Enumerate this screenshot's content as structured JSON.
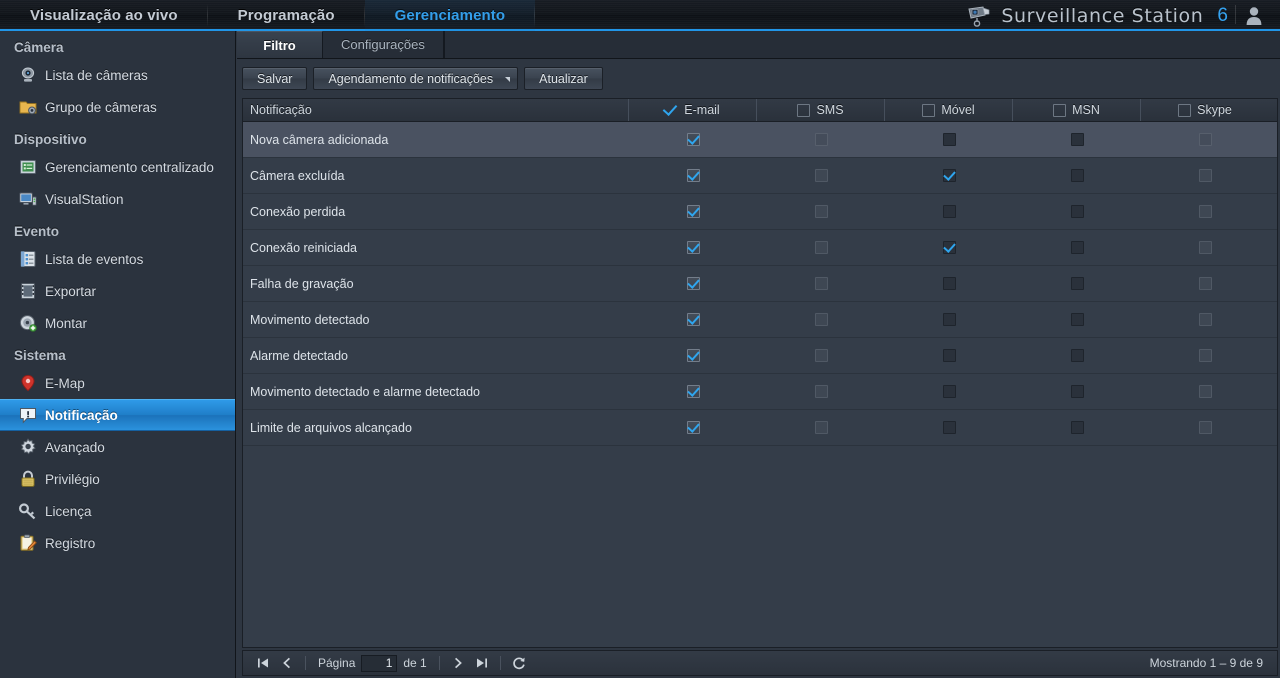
{
  "header": {
    "nav": [
      {
        "label": "Visualização ao vivo",
        "active": false
      },
      {
        "label": "Programação",
        "active": false
      },
      {
        "label": "Gerenciamento",
        "active": true
      }
    ],
    "brand": "Surveillance Station",
    "brand_version": "6",
    "camera_icon": "camera-icon",
    "user_icon": "user-icon",
    "accent": "#2196e8"
  },
  "sidebar": {
    "groups": [
      {
        "title": "Câmera",
        "items": [
          {
            "label": "Lista de câmeras",
            "icon": "camera-icon",
            "selected": false
          },
          {
            "label": "Grupo de câmeras",
            "icon": "folder-camera-icon",
            "selected": false
          }
        ]
      },
      {
        "title": "Dispositivo",
        "items": [
          {
            "label": "Gerenciamento centralizado",
            "icon": "server-list-icon",
            "selected": false
          },
          {
            "label": "VisualStation",
            "icon": "monitor-icon",
            "selected": false
          }
        ]
      },
      {
        "title": "Evento",
        "items": [
          {
            "label": "Lista de eventos",
            "icon": "event-list-icon",
            "selected": false
          },
          {
            "label": "Exportar",
            "icon": "film-export-icon",
            "selected": false
          },
          {
            "label": "Montar",
            "icon": "disc-mount-icon",
            "selected": false
          }
        ]
      },
      {
        "title": "Sistema",
        "items": [
          {
            "label": "E-Map",
            "icon": "map-pin-icon",
            "selected": false
          },
          {
            "label": "Notificação",
            "icon": "notification-bubble-icon",
            "selected": true
          },
          {
            "label": "Avançado",
            "icon": "gear-icon",
            "selected": false
          },
          {
            "label": "Privilégio",
            "icon": "lock-icon",
            "selected": false
          },
          {
            "label": "Licença",
            "icon": "key-icon",
            "selected": false
          },
          {
            "label": "Registro",
            "icon": "clipboard-pencil-icon",
            "selected": false
          }
        ]
      }
    ]
  },
  "main": {
    "tabs": [
      {
        "label": "Filtro",
        "active": true
      },
      {
        "label": "Configurações",
        "active": false
      }
    ],
    "toolbar": {
      "save_label": "Salvar",
      "schedule_label": "Agendamento de notificações",
      "refresh_label": "Atualizar"
    },
    "table": {
      "columns": [
        {
          "label": "Notificação",
          "type": "text",
          "header_checkbox": null
        },
        {
          "label": "E-mail",
          "type": "check",
          "header_checkbox": "checked"
        },
        {
          "label": "SMS",
          "type": "check",
          "header_checkbox": "unchecked"
        },
        {
          "label": "Móvel",
          "type": "check",
          "header_checkbox": "unchecked"
        },
        {
          "label": "MSN",
          "type": "check",
          "header_checkbox": "unchecked"
        },
        {
          "label": "Skype",
          "type": "check",
          "header_checkbox": "unchecked"
        }
      ],
      "rows": [
        {
          "name": "Nova câmera adicionada",
          "email": true,
          "sms": false,
          "mobile": false,
          "msn": false,
          "skype": false,
          "highlighted": true
        },
        {
          "name": "Câmera excluída",
          "email": true,
          "sms": false,
          "mobile": true,
          "msn": false,
          "skype": false,
          "highlighted": false
        },
        {
          "name": "Conexão perdida",
          "email": true,
          "sms": false,
          "mobile": false,
          "msn": false,
          "skype": false,
          "highlighted": false
        },
        {
          "name": "Conexão reiniciada",
          "email": true,
          "sms": false,
          "mobile": true,
          "msn": false,
          "skype": false,
          "highlighted": false
        },
        {
          "name": "Falha de gravação",
          "email": true,
          "sms": false,
          "mobile": false,
          "msn": false,
          "skype": false,
          "highlighted": false
        },
        {
          "name": "Movimento detectado",
          "email": true,
          "sms": false,
          "mobile": false,
          "msn": false,
          "skype": false,
          "highlighted": false
        },
        {
          "name": "Alarme detectado",
          "email": true,
          "sms": false,
          "mobile": false,
          "msn": false,
          "skype": false,
          "highlighted": false
        },
        {
          "name": "Movimento detectado e alarme detectado",
          "email": true,
          "sms": false,
          "mobile": false,
          "msn": false,
          "skype": false,
          "highlighted": false
        },
        {
          "name": "Limite de arquivos alcançado",
          "email": true,
          "sms": false,
          "mobile": false,
          "msn": false,
          "skype": false,
          "highlighted": false
        }
      ]
    },
    "pagination": {
      "first_icon": "first-page-icon",
      "prev_icon": "prev-page-icon",
      "next_icon": "next-page-icon",
      "last_icon": "last-page-icon",
      "refresh_icon": "refresh-icon",
      "page_label": "Página",
      "page_value": "1",
      "of_label": "de 1",
      "showing": "Mostrando 1 – 9 de 9"
    }
  }
}
